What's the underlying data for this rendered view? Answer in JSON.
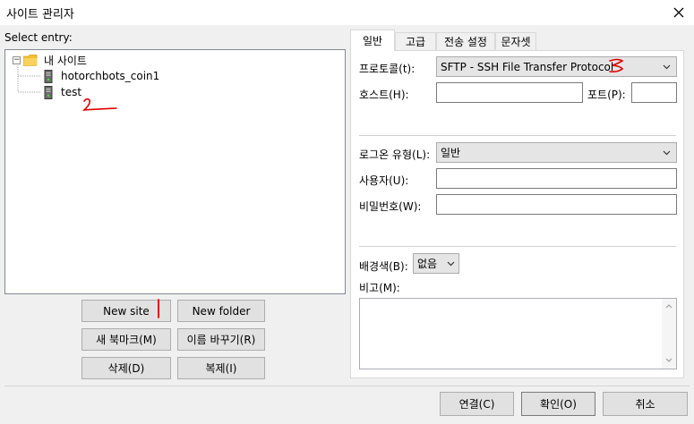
{
  "window": {
    "title": "사이트 관리자"
  },
  "select_entry_label": "Select entry:",
  "tree": {
    "root": {
      "label": "내 사이트",
      "expander": "−"
    },
    "children": [
      {
        "label": "hotorchbots_coin1"
      },
      {
        "label": "test"
      }
    ]
  },
  "buttons": {
    "new_site": "New site",
    "new_folder": "New folder",
    "new_bookmark": "새 북마크(M)",
    "rename": "이름 바꾸기(R)",
    "delete": "삭제(D)",
    "duplicate": "복제(I)"
  },
  "tabs": [
    "일반",
    "고급",
    "전송 설정",
    "문자셋"
  ],
  "general": {
    "protocol_label": "프로토콜(t):",
    "protocol_value": "SFTP - SSH File Transfer Protocol",
    "host_label": "호스트(H):",
    "host_value": "",
    "port_label": "포트(P):",
    "port_value": "",
    "logon_type_label": "로그온 유형(L):",
    "logon_type_value": "일반",
    "user_label": "사용자(U):",
    "user_value": "",
    "password_label": "비밀번호(W):",
    "password_value": "",
    "background_label": "배경색(B):",
    "background_value": "없음",
    "comments_label": "비고(M):",
    "comments_value": ""
  },
  "footer": {
    "connect": "연결(C)",
    "ok": "확인(O)",
    "cancel": "취소"
  },
  "annotations": {
    "one": "1",
    "two": "2",
    "three": "3"
  },
  "icons": {
    "close": "close-icon",
    "folder": "folder-icon",
    "server": "server-icon",
    "dropdown": "chevron-down-icon"
  },
  "colors": {
    "annotation": "#e00000",
    "folder": "#f2c12e"
  }
}
